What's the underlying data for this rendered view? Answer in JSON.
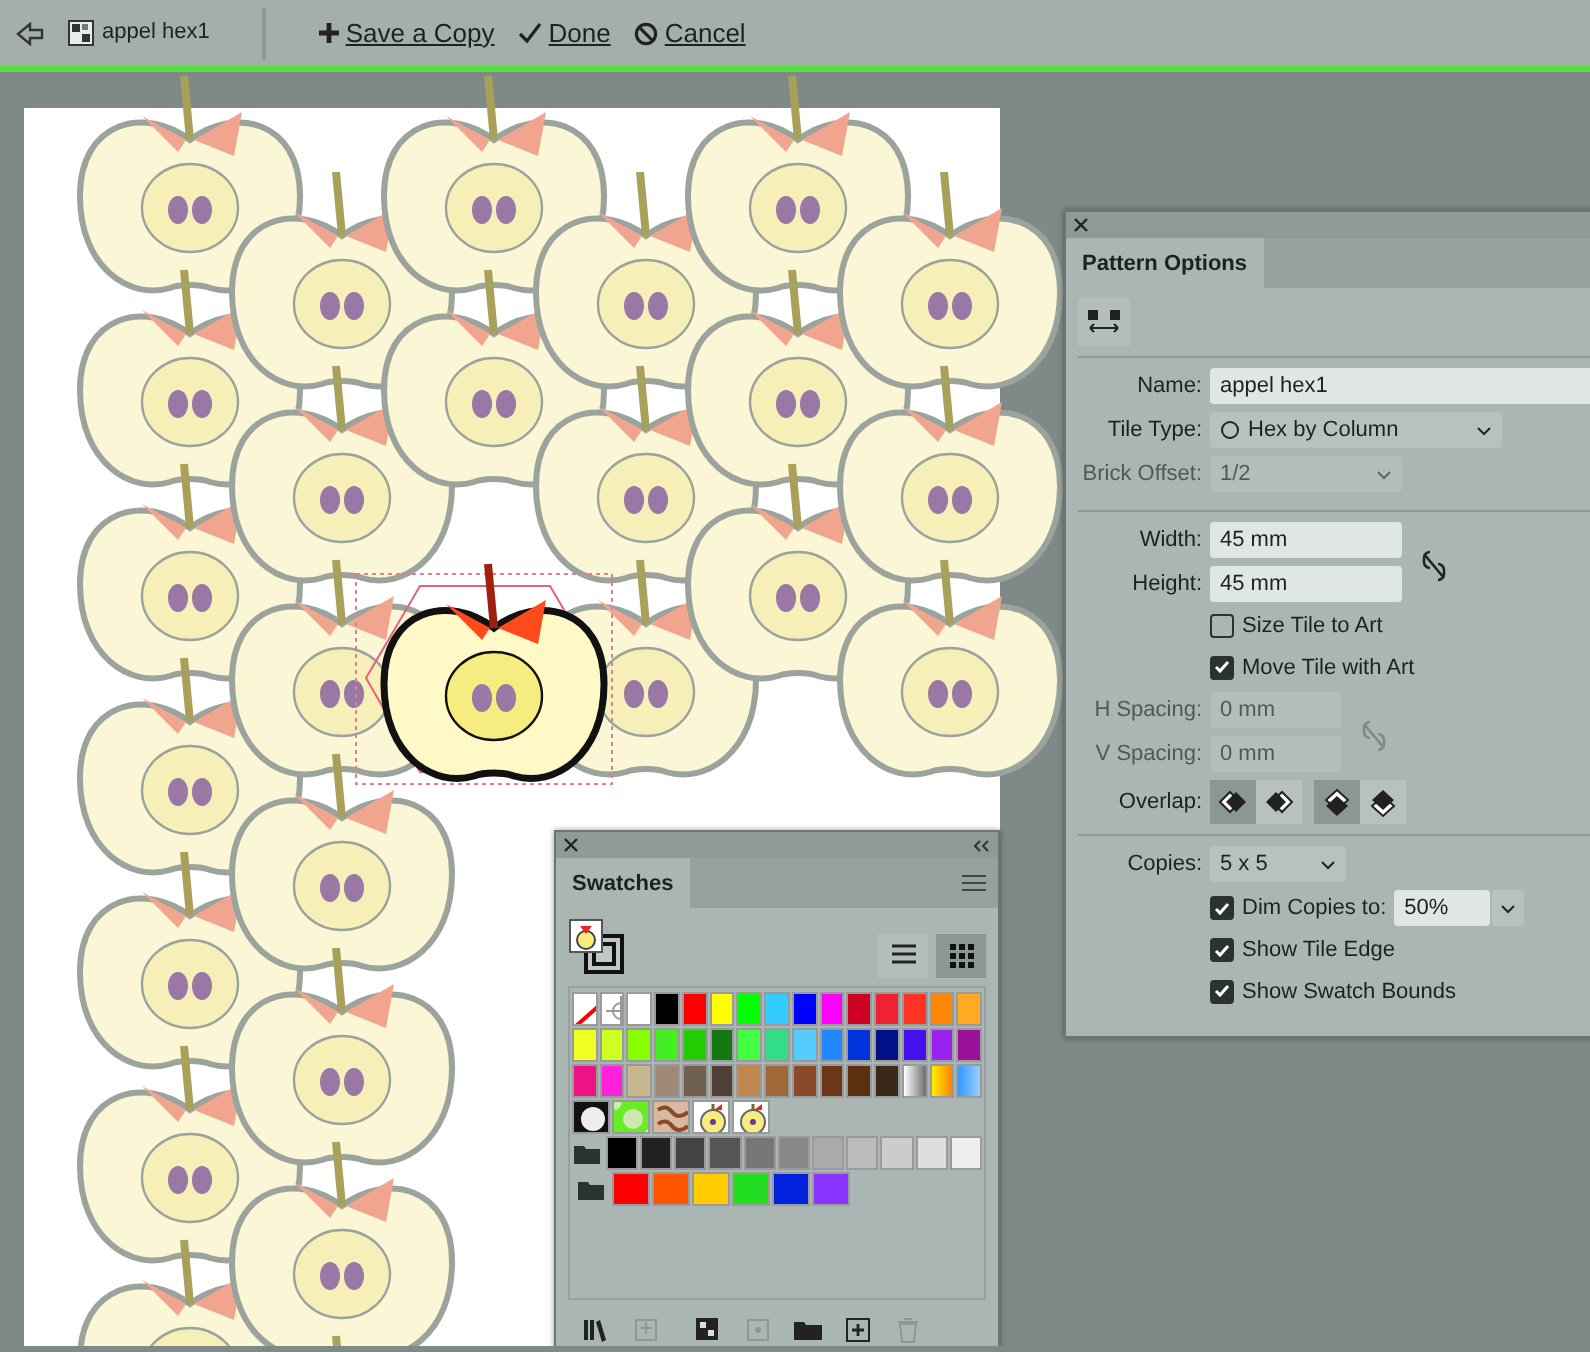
{
  "toolbar": {
    "document": "appel hex1",
    "actions": [
      {
        "kind": "plus",
        "label": "Save a Copy"
      },
      {
        "kind": "check",
        "label": "Done"
      },
      {
        "kind": "cancel",
        "label": "Cancel"
      }
    ]
  },
  "pattern_options": {
    "title": "Pattern Options",
    "name": {
      "label": "Name:",
      "value": "appel hex1"
    },
    "tile_type": {
      "label": "Tile Type:",
      "value": "Hex by Column"
    },
    "brick_offset": {
      "label": "Brick Offset:",
      "value": "1/2",
      "disabled": true
    },
    "width": {
      "label": "Width:",
      "value": "45 mm"
    },
    "height": {
      "label": "Height:",
      "value": "45 mm"
    },
    "checks_1": [
      {
        "label": "Size Tile to Art",
        "checked": false
      },
      {
        "label": "Move Tile with Art",
        "checked": true
      }
    ],
    "h_spacing": {
      "label": "H Spacing:",
      "value": "0 mm",
      "disabled": true
    },
    "v_spacing": {
      "label": "V Spacing:",
      "value": "0 mm",
      "disabled": true
    },
    "overlap": {
      "label": "Overlap:",
      "options": [
        {
          "kind": "left",
          "selected": true
        },
        {
          "kind": "right",
          "selected": false
        },
        {
          "kind": "top",
          "selected": true
        },
        {
          "kind": "bottom",
          "selected": false
        }
      ]
    },
    "copies": {
      "label": "Copies:",
      "value": "5 x 5"
    },
    "dim_copies": {
      "label": "Dim Copies to:",
      "checked": true,
      "value": "50%"
    },
    "checks_2": [
      {
        "label": "Show Tile Edge",
        "checked": true
      },
      {
        "label": "Show Swatch Bounds",
        "checked": true
      }
    ]
  },
  "swatches": {
    "title": "Swatches",
    "views": [
      {
        "kind": "list",
        "selected": false
      },
      {
        "kind": "grid",
        "selected": true
      }
    ],
    "rows": [
      {
        "folder": false,
        "items": [
          {
            "kind": "none"
          },
          {
            "kind": "registration"
          },
          {
            "kind": "color",
            "color": "#ffffff"
          },
          {
            "kind": "color",
            "color": "#000000"
          },
          {
            "kind": "color",
            "color": "#ff0000"
          },
          {
            "kind": "color",
            "color": "#ffff00"
          },
          {
            "kind": "color",
            "color": "#00ff00"
          },
          {
            "kind": "color",
            "color": "#33ccff"
          },
          {
            "kind": "color",
            "color": "#0000ff"
          },
          {
            "kind": "color",
            "color": "#ff00ff"
          },
          {
            "kind": "color",
            "color": "#cc0022"
          },
          {
            "kind": "color",
            "color": "#ee2233"
          },
          {
            "kind": "color",
            "color": "#ff3322"
          },
          {
            "kind": "color",
            "color": "#ff8800"
          },
          {
            "kind": "color",
            "color": "#ffaa22"
          }
        ]
      },
      {
        "folder": false,
        "items": [
          {
            "kind": "color",
            "color": "#eeff22"
          },
          {
            "kind": "color",
            "color": "#ccff22"
          },
          {
            "kind": "color",
            "color": "#88ff00"
          },
          {
            "kind": "color",
            "color": "#44ee22"
          },
          {
            "kind": "color",
            "color": "#22cc00"
          },
          {
            "kind": "color",
            "color": "#117711"
          },
          {
            "kind": "color",
            "color": "#44ff44"
          },
          {
            "kind": "color",
            "color": "#33dd88"
          },
          {
            "kind": "color",
            "color": "#55ccff"
          },
          {
            "kind": "color",
            "color": "#2288ff"
          },
          {
            "kind": "color",
            "color": "#0033dd"
          },
          {
            "kind": "color",
            "color": "#001188"
          },
          {
            "kind": "color",
            "color": "#4411ee"
          },
          {
            "kind": "color",
            "color": "#9922ee"
          },
          {
            "kind": "color",
            "color": "#991199"
          }
        ]
      },
      {
        "folder": false,
        "items": [
          {
            "kind": "color",
            "color": "#ee1188"
          },
          {
            "kind": "color",
            "color": "#ff22dd"
          },
          {
            "kind": "color",
            "color": "#c8b890"
          },
          {
            "kind": "color",
            "color": "#a08878"
          },
          {
            "kind": "color",
            "color": "#706050"
          },
          {
            "kind": "color",
            "color": "#504038"
          },
          {
            "kind": "color",
            "color": "#c08850"
          },
          {
            "kind": "color",
            "color": "#a06838"
          },
          {
            "kind": "color",
            "color": "#8a4a28"
          },
          {
            "kind": "color",
            "color": "#6a3818"
          },
          {
            "kind": "color",
            "color": "#5a3010"
          },
          {
            "kind": "color",
            "color": "#3a2818"
          },
          {
            "kind": "gradient-gray"
          },
          {
            "kind": "gradient-orange"
          },
          {
            "kind": "gradient-blue"
          }
        ]
      },
      {
        "folder": false,
        "items": [
          {
            "kind": "pattern-dots"
          },
          {
            "kind": "pattern-green"
          },
          {
            "kind": "pattern-brown"
          },
          {
            "kind": "pattern-apple"
          },
          {
            "kind": "pattern-apple"
          }
        ]
      },
      {
        "folder": true,
        "items": [
          {
            "kind": "color",
            "color": "#000000"
          },
          {
            "kind": "color",
            "color": "#222222"
          },
          {
            "kind": "color",
            "color": "#444444"
          },
          {
            "kind": "color",
            "color": "#555555"
          },
          {
            "kind": "color",
            "color": "#777777"
          },
          {
            "kind": "color",
            "color": "#888888"
          },
          {
            "kind": "color",
            "color": "#aaaaaa"
          },
          {
            "kind": "color",
            "color": "#bbbbbb"
          },
          {
            "kind": "color",
            "color": "#cccccc"
          },
          {
            "kind": "color",
            "color": "#dddddd"
          },
          {
            "kind": "color",
            "color": "#eeeeee"
          }
        ]
      },
      {
        "folder": true,
        "items": [
          {
            "kind": "color",
            "color": "#ff0000"
          },
          {
            "kind": "color",
            "color": "#ff5500"
          },
          {
            "kind": "color",
            "color": "#ffcc00"
          },
          {
            "kind": "color",
            "color": "#22dd22"
          },
          {
            "kind": "color",
            "color": "#0022dd"
          },
          {
            "kind": "color",
            "color": "#8833ff"
          }
        ]
      }
    ],
    "tools": [
      {
        "kind": "library",
        "disabled": false
      },
      {
        "kind": "place",
        "disabled": true
      },
      {
        "kind": "kinds",
        "disabled": false
      },
      {
        "kind": "options",
        "disabled": true
      },
      {
        "kind": "folder",
        "disabled": false
      },
      {
        "kind": "new",
        "disabled": false
      },
      {
        "kind": "delete",
        "disabled": true
      }
    ]
  }
}
